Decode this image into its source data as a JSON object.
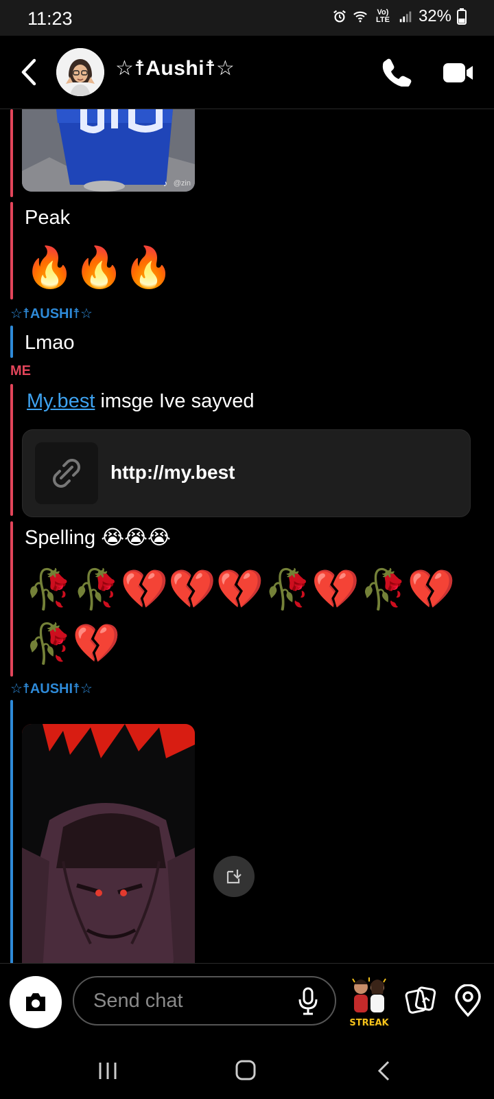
{
  "status_bar": {
    "time": "11:23",
    "network": "Vo) LTE",
    "battery": "32%"
  },
  "header": {
    "contact_name": "☆☨Aushi☨☆",
    "icons": [
      "back-icon",
      "phone-icon",
      "video-call-icon"
    ]
  },
  "messages": [
    {
      "type": "image",
      "sender": "me",
      "watermark": "@zin"
    },
    {
      "type": "text",
      "sender": "me",
      "text": "Peak"
    },
    {
      "type": "emoji",
      "sender": "me",
      "text": "🔥🔥🔥"
    },
    {
      "type": "sender_label",
      "text": "☆☨AUSHI☨☆"
    },
    {
      "type": "text",
      "sender": "them",
      "text": "Lmao"
    },
    {
      "type": "sender_label",
      "text": "ME"
    },
    {
      "type": "link_text",
      "sender": "me",
      "link": "My.best",
      "text": " imsge Ive sayved"
    },
    {
      "type": "link_card",
      "sender": "me",
      "url": "http://my.best"
    },
    {
      "type": "text",
      "sender": "me",
      "text": "Spelling 😭😭😭"
    },
    {
      "type": "emoji",
      "sender": "me",
      "text": "🥀🥀💔💔💔🥀💔🥀💔"
    },
    {
      "type": "emoji",
      "sender": "me",
      "text": "🥀💔"
    },
    {
      "type": "sender_label",
      "text": "☆☨AUSHI☨☆"
    },
    {
      "type": "image",
      "sender": "them"
    }
  ],
  "composer": {
    "placeholder": "Send chat",
    "streak_label": "STREAK",
    "icons": [
      "camera-icon",
      "mic-icon",
      "gallery-icon",
      "map-pin-icon"
    ]
  },
  "colors": {
    "me": "#e2455a",
    "them": "#2e8ad8",
    "link": "#3ea2f0"
  }
}
